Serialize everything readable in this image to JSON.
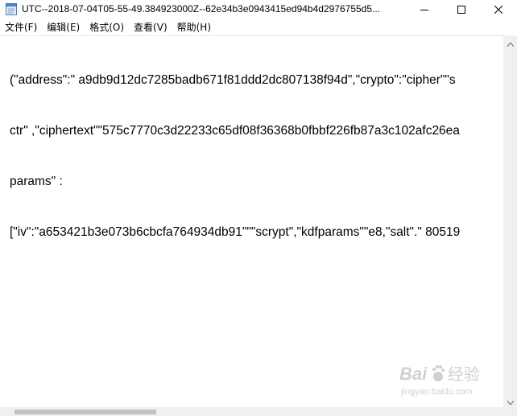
{
  "window": {
    "title": "UTC--2018-07-04T05-55-49.384923000Z--62e34b3e0943415ed94b4d2976755d5...",
    "controls": {
      "minimize": "minimize-icon",
      "maximize": "maximize-icon",
      "close": "close-icon"
    }
  },
  "menu": {
    "items": [
      {
        "label": "文件(F)"
      },
      {
        "label": "编辑(E)"
      },
      {
        "label": "格式(O)"
      },
      {
        "label": "查看(V)"
      },
      {
        "label": "帮助(H)"
      }
    ]
  },
  "editor": {
    "lines": [
      "(\"address\":\" a9db9d12dc7285badb671f81ddd2dc807138f94d\",\"crypto\":\"cipher\"\"s",
      "ctr\" ,\"ciphertext\"\"575c7770c3d22233c65df08f36368b0fbbf226fb87a3c102afc26ea",
      "params\" :",
      "[\"iv\":\"a653421b3e073b6cbcfa764934db91\"\"\"scrypt\",\"kdfparams\"\"e8,\"salt\".\" 80519"
    ]
  },
  "watermark": {
    "brand": "Bai",
    "brand_suffix": "经验",
    "url": "jingyan.baidu.com"
  }
}
